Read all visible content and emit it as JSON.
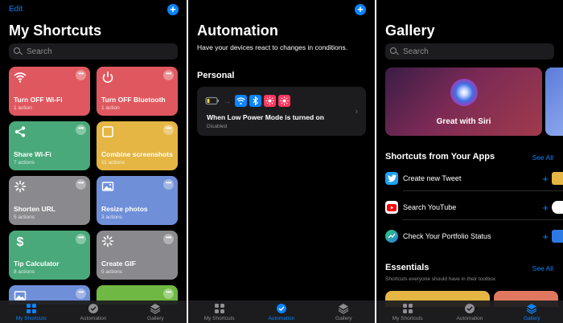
{
  "screen1": {
    "edit_label": "Edit",
    "add_label": "+",
    "title": "My Shortcuts",
    "search_placeholder": "Search",
    "tiles": [
      {
        "name": "Turn OFF Wi-Fi",
        "sub": "1 action",
        "color": "#e0585f",
        "icon": "wifi-icon"
      },
      {
        "name": "Turn OFF Bluetooth",
        "sub": "1 action",
        "color": "#e0585f",
        "icon": "power-icon"
      },
      {
        "name": "Share Wi-Fi",
        "sub": "7 actions",
        "color": "#4aa97a",
        "icon": "share-icon"
      },
      {
        "name": "Combine screenshots",
        "sub": "11 actions",
        "color": "#e5b643",
        "icon": "square-icon"
      },
      {
        "name": "Shorten URL",
        "sub": "5 actions",
        "color": "#8a8a8e",
        "icon": "loader-icon"
      },
      {
        "name": "Resize photos",
        "sub": "3 actions",
        "color": "#6f8fd8",
        "icon": "image-icon"
      },
      {
        "name": "Tip Calculator",
        "sub": "8 actions",
        "color": "#4aa97a",
        "icon": "dollar-icon"
      },
      {
        "name": "Create GIF",
        "sub": "5 actions",
        "color": "#8a8a8e",
        "icon": "loader-icon"
      }
    ],
    "partial_tiles": [
      {
        "color": "#6f8fd8"
      },
      {
        "color": "#6fb844"
      }
    ]
  },
  "screen2": {
    "add_label": "+",
    "title": "Automation",
    "description": "Have your devices react to changes in conditions.",
    "section": "Personal",
    "card": {
      "title": "When Low Power Mode is turned on",
      "status": "Disabled"
    }
  },
  "screen3": {
    "title": "Gallery",
    "search_placeholder": "Search",
    "hero_title": "Great with Siri",
    "apps_section": "Shortcuts from Your Apps",
    "see_all": "See All",
    "apps": [
      {
        "label": "Create new Tweet",
        "icon": "twitter-icon",
        "color": "#1da1f2"
      },
      {
        "label": "Search YouTube",
        "icon": "youtube-icon",
        "color": "#ffffff"
      },
      {
        "label": "Check Your Portfolio Status",
        "icon": "portfolio-icon",
        "color": "#2c7be5"
      }
    ],
    "essentials_section": "Essentials",
    "essentials_see_all": "See All",
    "essentials_sub": "Shortcuts everyone should have in their toolbox"
  },
  "tabs": [
    {
      "label": "My Shortcuts"
    },
    {
      "label": "Automation"
    },
    {
      "label": "Gallery"
    }
  ],
  "colors": {
    "accent": "#0a84ff",
    "card": "#1c1c1e"
  }
}
